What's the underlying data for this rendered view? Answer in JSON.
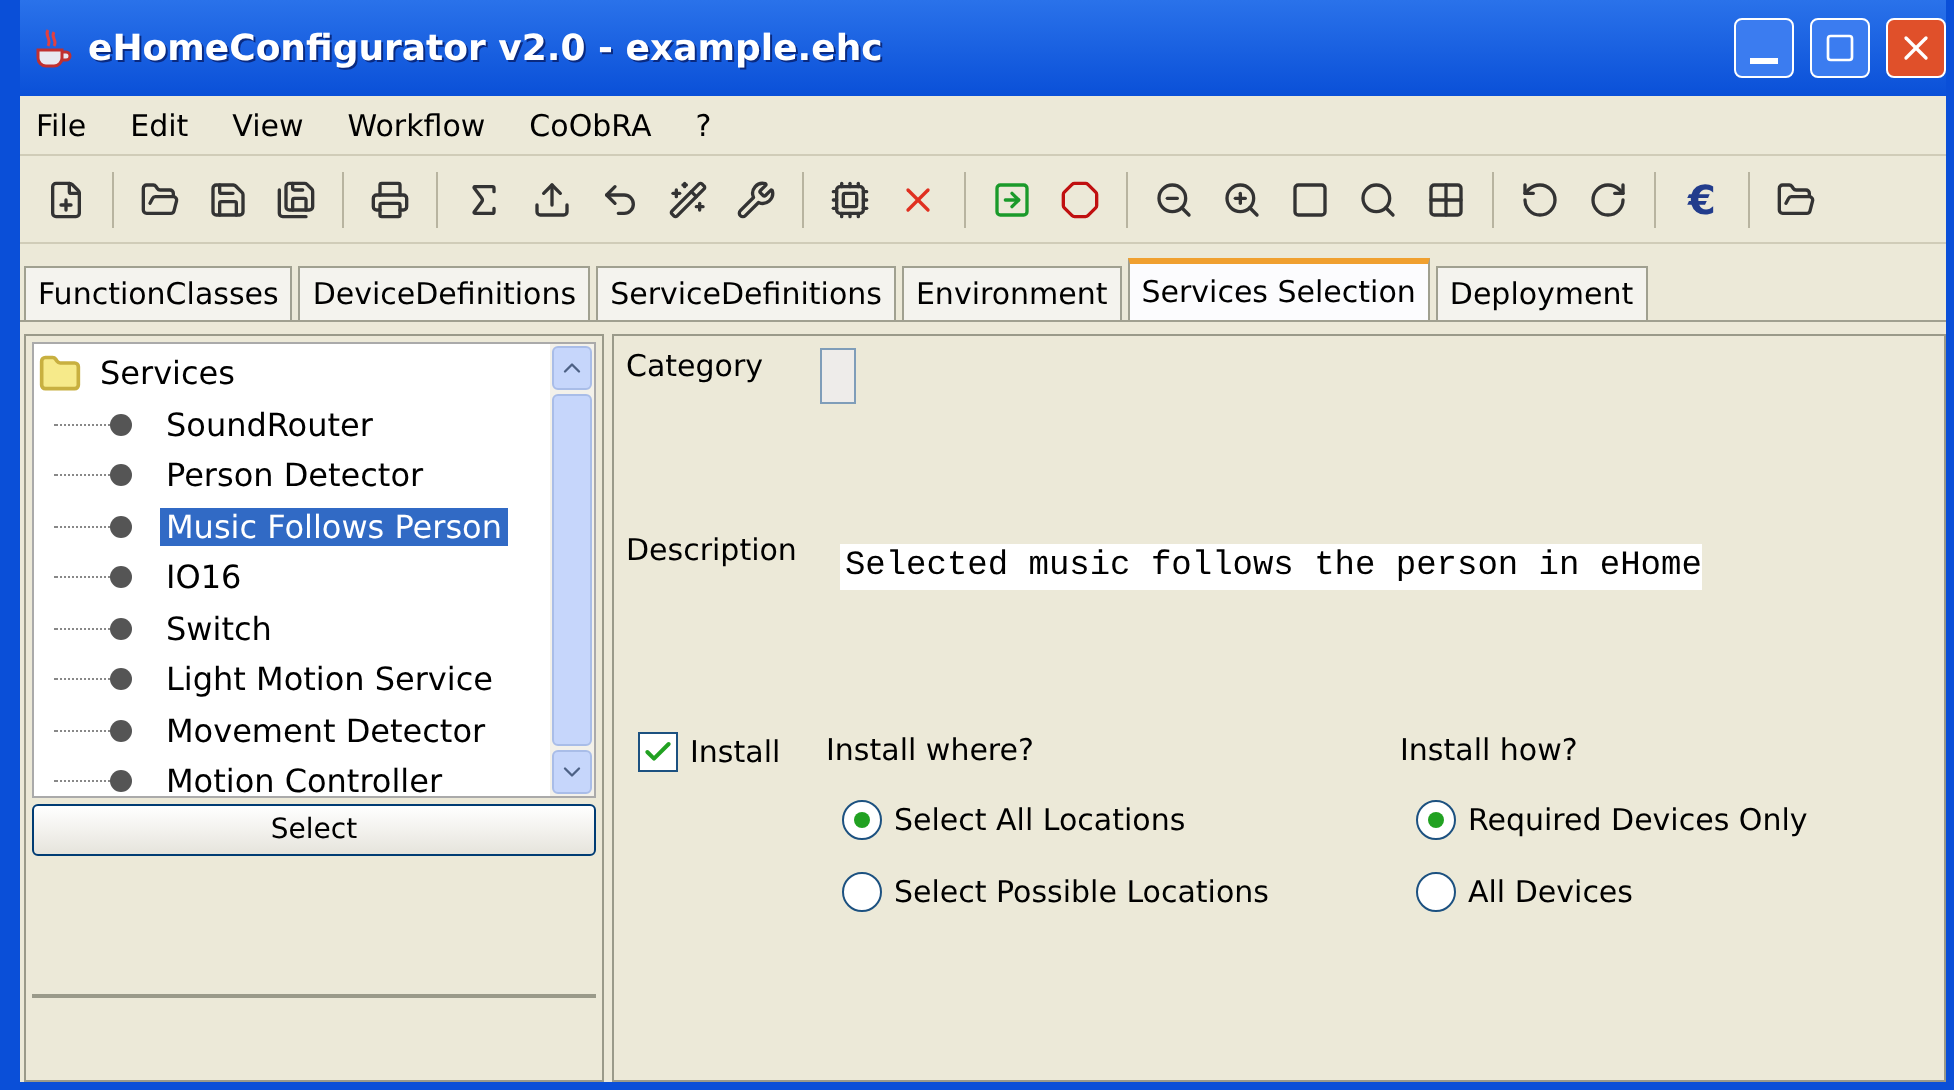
{
  "window": {
    "title": "eHomeConfigurator v2.0 - example.ehc"
  },
  "menu": [
    "File",
    "Edit",
    "View",
    "Workflow",
    "CoObRA",
    "?"
  ],
  "toolbar": {
    "currency_symbol": "€"
  },
  "tabs": [
    {
      "label": "FunctionClasses",
      "selected": false
    },
    {
      "label": "DeviceDefinitions",
      "selected": false
    },
    {
      "label": "ServiceDefinitions",
      "selected": false
    },
    {
      "label": "Environment",
      "selected": false
    },
    {
      "label": "Services Selection",
      "selected": true
    },
    {
      "label": "Deployment",
      "selected": false
    }
  ],
  "tree": {
    "label": "Services",
    "children": [
      {
        "label": "SoundRouter",
        "selected": false
      },
      {
        "label": "Person Detector",
        "selected": false
      },
      {
        "label": "Music Follows Person",
        "selected": true
      },
      {
        "label": "IO16",
        "selected": false
      },
      {
        "label": "Switch",
        "selected": false
      },
      {
        "label": "Light Motion Service",
        "selected": false
      },
      {
        "label": "Movement Detector",
        "selected": false
      },
      {
        "label": "Motion Controller",
        "selected": false
      }
    ]
  },
  "select_button": "Select",
  "details": {
    "category_label": "Category",
    "description_label": "Description",
    "description": "Selected music follows the person in eHome",
    "install": {
      "label": "Install",
      "checked": true
    },
    "install_where": {
      "label": "Install where?",
      "options": [
        {
          "label": "Select All Locations",
          "selected": true
        },
        {
          "label": "Select Possible Locations",
          "selected": false
        }
      ]
    },
    "install_how": {
      "label": "Install how?",
      "options": [
        {
          "label": "Required Devices Only",
          "selected": true
        },
        {
          "label": "All Devices",
          "selected": false
        }
      ]
    }
  }
}
